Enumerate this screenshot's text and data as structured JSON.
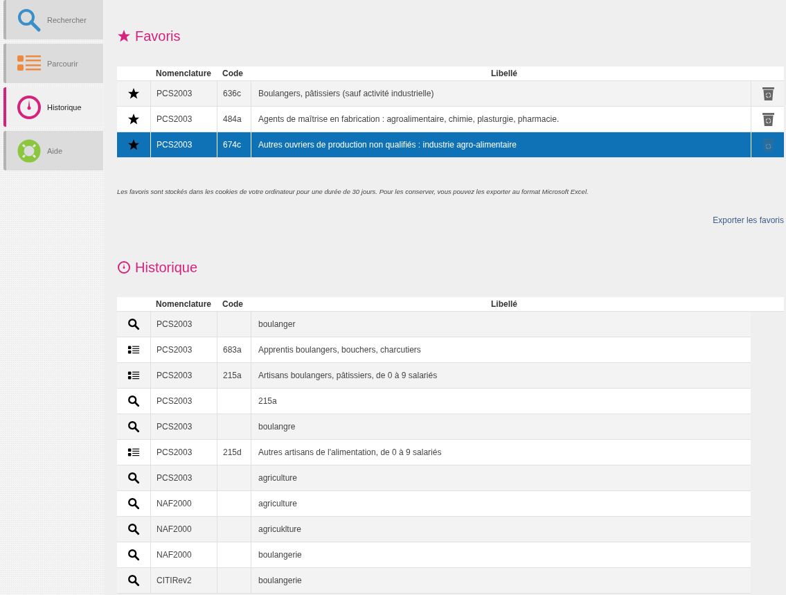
{
  "sidebar": {
    "items": [
      {
        "kind": "search",
        "label": "Rechercher",
        "selected": false
      },
      {
        "kind": "browse",
        "label": "Parcourir",
        "selected": false
      },
      {
        "kind": "history",
        "label": "Historique",
        "selected": true
      },
      {
        "kind": "help",
        "label": "Aide",
        "selected": false
      }
    ]
  },
  "favorites": {
    "title": "Favoris",
    "columns": [
      "Nomenclature",
      "Code",
      "Libellé"
    ],
    "rows": [
      {
        "nomenclature": "PCS2003",
        "code": "636c",
        "label": "Boulangers, pâtissiers (sauf activité industrielle)",
        "selected": false
      },
      {
        "nomenclature": "PCS2003",
        "code": "484a",
        "label": "Agents de maîtrise en fabrication : agroalimentaire, chimie, plasturgie, pharmacie.",
        "selected": false
      },
      {
        "nomenclature": "PCS2003",
        "code": "674c",
        "label": "Autres ouvriers de production non qualifiés : industrie agro-alimentaire",
        "selected": true
      }
    ],
    "note": "Les favoris sont stockés dans les cookies de votre ordinateur pour une durée de 30 jours. Pour les conserver, vous pouvez les exporter au format Microsoft Excel.",
    "export_link": "Exporter les favoris"
  },
  "history": {
    "title": "Historique",
    "columns": [
      "Nomenclature",
      "Code",
      "Libellé"
    ],
    "rows": [
      {
        "kind": "search",
        "nomenclature": "PCS2003",
        "code": "",
        "label": "boulanger"
      },
      {
        "kind": "browse",
        "nomenclature": "PCS2003",
        "code": "683a",
        "label": "Apprentis boulangers, bouchers, charcutiers"
      },
      {
        "kind": "browse",
        "nomenclature": "PCS2003",
        "code": "215a",
        "label": "Artisans boulangers, pâtissiers, de 0 à 9 salariés"
      },
      {
        "kind": "search",
        "nomenclature": "PCS2003",
        "code": "",
        "label": "215a"
      },
      {
        "kind": "search",
        "nomenclature": "PCS2003",
        "code": "",
        "label": "boulangre"
      },
      {
        "kind": "browse",
        "nomenclature": "PCS2003",
        "code": "215d",
        "label": "Autres artisans de l'alimentation, de 0 à 9 salariés"
      },
      {
        "kind": "search",
        "nomenclature": "PCS2003",
        "code": "",
        "label": "agriculture"
      },
      {
        "kind": "search",
        "nomenclature": "NAF2000",
        "code": "",
        "label": "agriculture"
      },
      {
        "kind": "search",
        "nomenclature": "NAF2000",
        "code": "",
        "label": "agricuklture"
      },
      {
        "kind": "search",
        "nomenclature": "NAF2000",
        "code": "",
        "label": "boulangerie"
      },
      {
        "kind": "search",
        "nomenclature": "CITIRev2",
        "code": "",
        "label": "boulangerie"
      }
    ]
  }
}
